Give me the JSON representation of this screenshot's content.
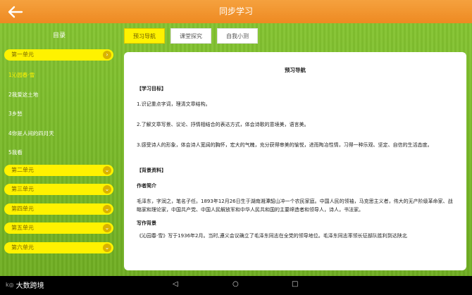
{
  "header": {
    "title": "同步学习"
  },
  "sidebar": {
    "title": "目录",
    "units": [
      {
        "label": "第一单元"
      },
      {
        "label": "第二单元"
      },
      {
        "label": "第三单元"
      },
      {
        "label": "第四单元"
      },
      {
        "label": "第五单元"
      },
      {
        "label": "第六单元"
      }
    ],
    "lessons": [
      {
        "label": "1沁园春·雪"
      },
      {
        "label": "2我爱这土地"
      },
      {
        "label": "3乡愁"
      },
      {
        "label": "4你是人间的四月天"
      },
      {
        "label": "5我看"
      }
    ]
  },
  "tabs": [
    {
      "label": "预习导航"
    },
    {
      "label": "课堂探究"
    },
    {
      "label": "自我小测"
    }
  ],
  "content": {
    "title": "预习导航",
    "s1_heading": "【学习目标】",
    "s1_p1": "1.识记重点字词，理清文章结构。",
    "s1_p2": "2.了解文章写景、议论、抒情相结合的表达方式，体会诗歌的意境美，语言美。",
    "s1_p3": "3.感受诗人的形象，体会诗人宽阔的胸怀，宏大的气魄，充分获得审美的愉悦，进而陶冶性情，习得一种乐观、坚定、自信的生活态度。",
    "s2_heading": "【背景资料】",
    "author_heading": "作者简介",
    "author_p": "毛泽东，字润之，笔名子任。1893年12月26日生于湖南湘潭韶山冲一个农民家庭。中国人民的领袖，马克思主义者，伟大的无产阶级革命家、战略家和理论家，中国共产党、中国人民解放军和中华人民共和国的主要缔造者和领导人，诗人，书法家。",
    "bg_heading": "写作背景",
    "bg_p": "《沁园春·雪》写于1936年2月。当时,遵义会议确立了毛泽东同志在全党的领导地位。毛泽东同志率领长征部队胜利到达陕北"
  },
  "footer": {
    "logo_text": "大数跨境"
  }
}
